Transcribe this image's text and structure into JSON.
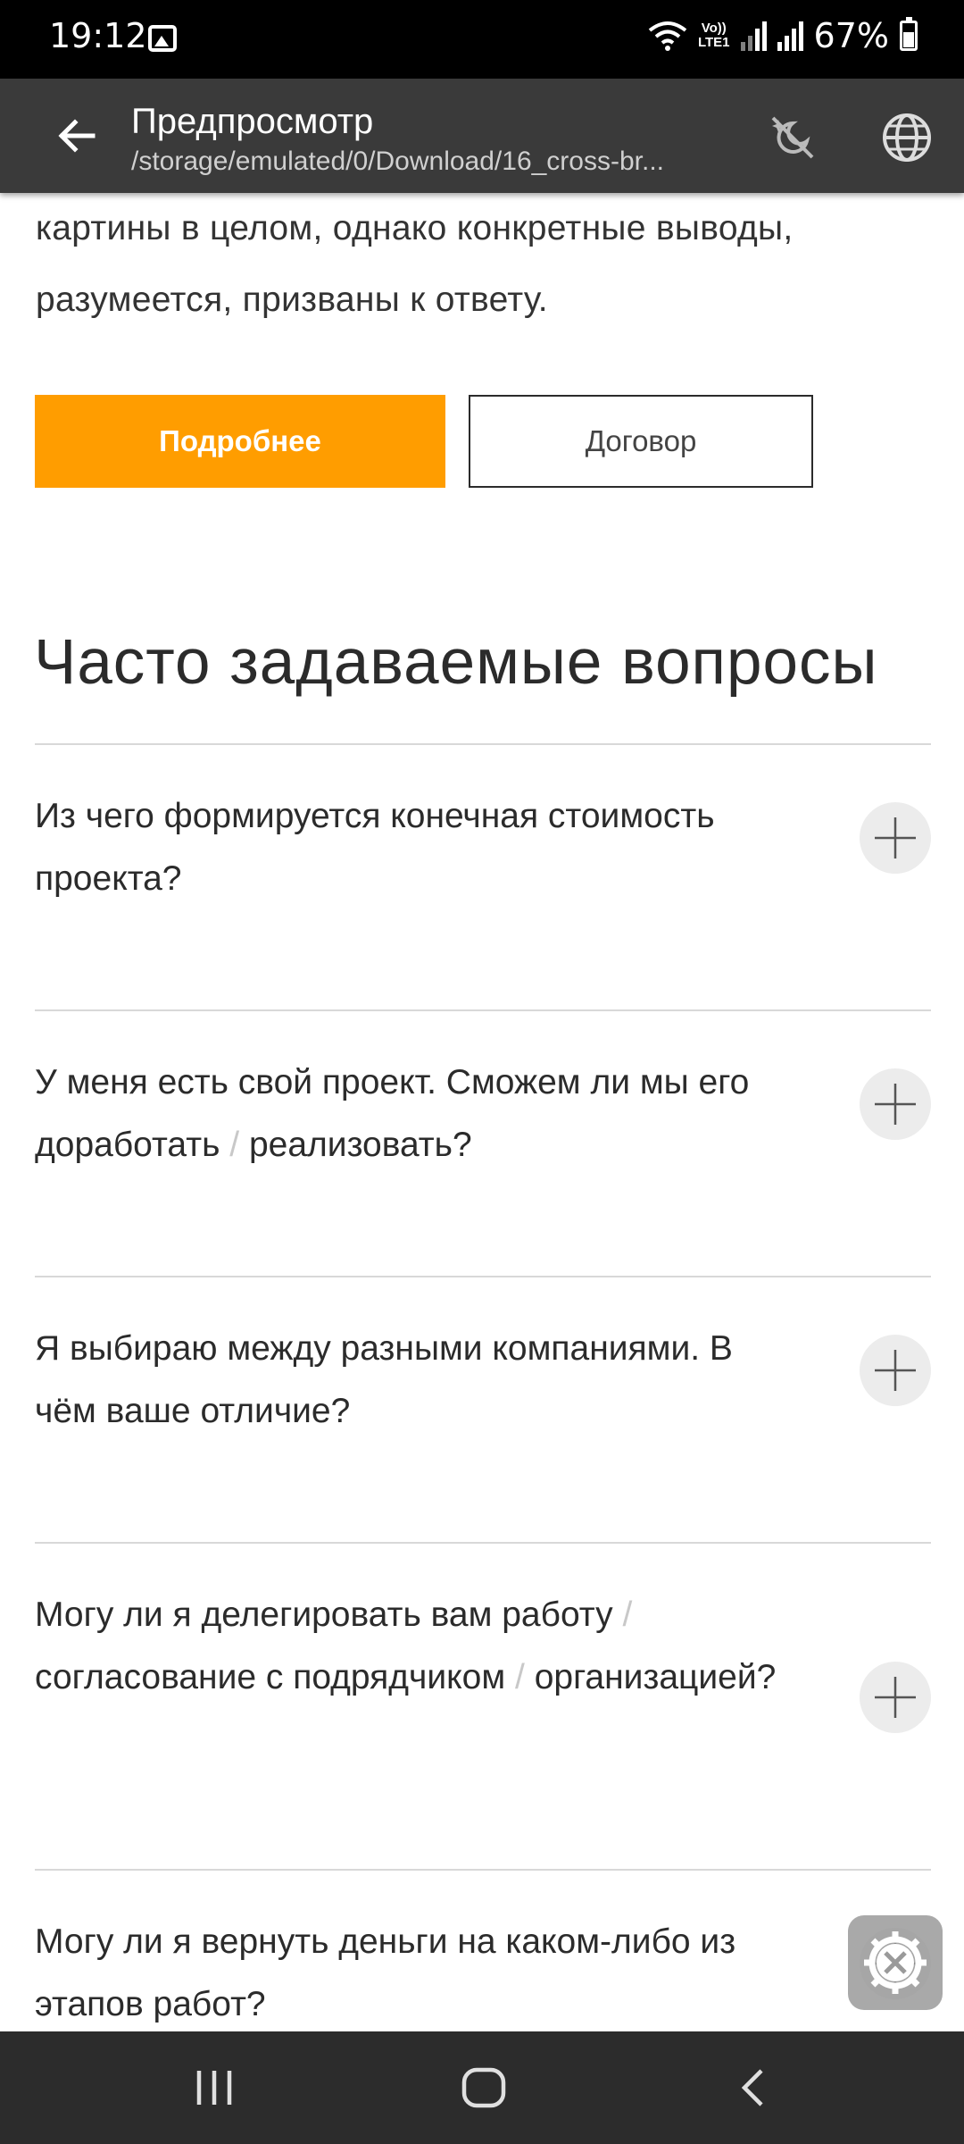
{
  "status_bar": {
    "time": "19:12",
    "volte_top": "Vo))",
    "volte_bottom": "LTE1",
    "battery": "67%"
  },
  "app_bar": {
    "title": "Предпросмотр",
    "subtitle": "/storage/emulated/0/Download/16_cross-br..."
  },
  "page": {
    "intro_text": "картины в целом, однако конкретные выводы, разумеется, призваны к ответу.",
    "more_button": "Подробнее",
    "contract_button": "Договор",
    "accent_color": "#ff9d00"
  },
  "faq": {
    "heading": "Часто задаваемые вопросы",
    "items": [
      {
        "parts": [
          "Из чего формируется конечная стоимость проекта?"
        ]
      },
      {
        "parts": [
          "У меня есть свой проект. Сможем ли мы его доработать",
          "реализовать?"
        ]
      },
      {
        "parts": [
          "Я выбираю между разными компаниями. В чём ваше отличие?"
        ]
      },
      {
        "parts": [
          "Могу ли я делегировать вам работу",
          "согласование с подрядчиком",
          "организацией?"
        ]
      },
      {
        "parts": [
          "Могу ли я вернуть деньги на каком-либо из этапов работ?"
        ]
      }
    ],
    "separator": "/"
  },
  "icons": {
    "back": "arrow-back-icon",
    "theme": "theme-toggle-icon",
    "globe": "globe-icon",
    "toggle": "plus-icon",
    "tool": "tools-gear-icon"
  }
}
